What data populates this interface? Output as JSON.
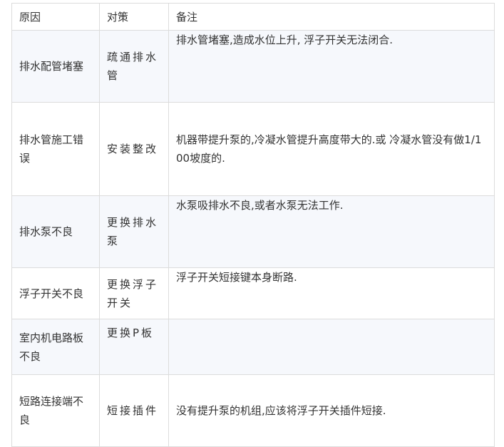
{
  "table": {
    "headers": [
      "原因",
      "对策",
      "备注"
    ],
    "rows": [
      {
        "cause": "排水配管堵塞",
        "measure": "疏通排水管",
        "note": "排水管堵塞,造成水位上升, 浮子开关无法闭合."
      },
      {
        "cause": "排水管施工错误",
        "measure": "安装整改",
        "note": "机器带提升泵的,冷凝水管提升高度带大的.或 冷凝水管没有做1/100坡度的."
      },
      {
        "cause": "排水泵不良",
        "measure": "更换排水泵",
        "note": "水泵吸排水不良,或者水泵无法工作."
      },
      {
        "cause": "浮子开关不良",
        "measure": "更换浮子开关",
        "note": "浮子开关短接键本身断路."
      },
      {
        "cause": "室内机电路板不良",
        "measure": "更换P板",
        "note": ""
      },
      {
        "cause": "短路连接端不良",
        "measure": "短接插件",
        "note": "没有提升泵的机组,应该将浮子开关插件短接."
      }
    ]
  }
}
